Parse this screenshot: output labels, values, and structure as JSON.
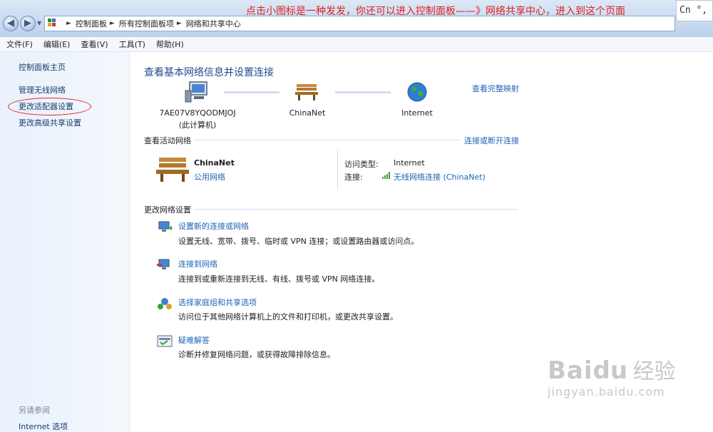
{
  "annotation": "点击小图标是一种发发，你还可以进入控制面板——》网络共享中心，进入到这个页面",
  "ime_indicator": "Cn °,",
  "breadcrumb": [
    "控制面板",
    "所有控制面板项",
    "网络和共享中心"
  ],
  "menu": [
    "文件(F)",
    "编辑(E)",
    "查看(V)",
    "工具(T)",
    "帮助(H)"
  ],
  "left_pane": {
    "home": "控制面板主页",
    "items": [
      "管理无线网络",
      "更改适配器设置",
      "更改高级共享设置"
    ],
    "see_also_title": "另请参阅",
    "see_also": [
      "Internet 选项"
    ]
  },
  "main": {
    "title": "查看基本网络信息并设置连接",
    "full_map_link": "查看完整映射",
    "map_nodes": [
      {
        "name": "7AE07V8YQODMJOJ",
        "sub": "(此计算机)"
      },
      {
        "name": "ChinaNet",
        "sub": ""
      },
      {
        "name": "Internet",
        "sub": ""
      }
    ],
    "active_networks_label": "查看活动网络",
    "connect_disconnect_link": "连接或断开连接",
    "network_name": "ChinaNet",
    "network_type": "公用网络",
    "access_type_label": "访问类型:",
    "access_type_value": "Internet",
    "connection_label": "连接:",
    "connection_value": "无线网络连接 (ChinaNet)",
    "change_settings_label": "更改网络设置",
    "tasks": [
      {
        "title": "设置新的连接或网络",
        "desc": "设置无线、宽带、拨号、临时或 VPN 连接；或设置路由器或访问点。"
      },
      {
        "title": "连接到网络",
        "desc": "连接到或重新连接到无线、有线、拨号或 VPN 网络连接。"
      },
      {
        "title": "选择家庭组和共享选项",
        "desc": "访问位于其他网络计算机上的文件和打印机，或更改共享设置。"
      },
      {
        "title": "疑难解答",
        "desc": "诊断并修复网络问题，或获得故障排除信息。"
      }
    ]
  },
  "watermark": {
    "brand": "Bai",
    "brand2": "du",
    "cn": "经验",
    "url": "jingyan.baidu.com"
  }
}
